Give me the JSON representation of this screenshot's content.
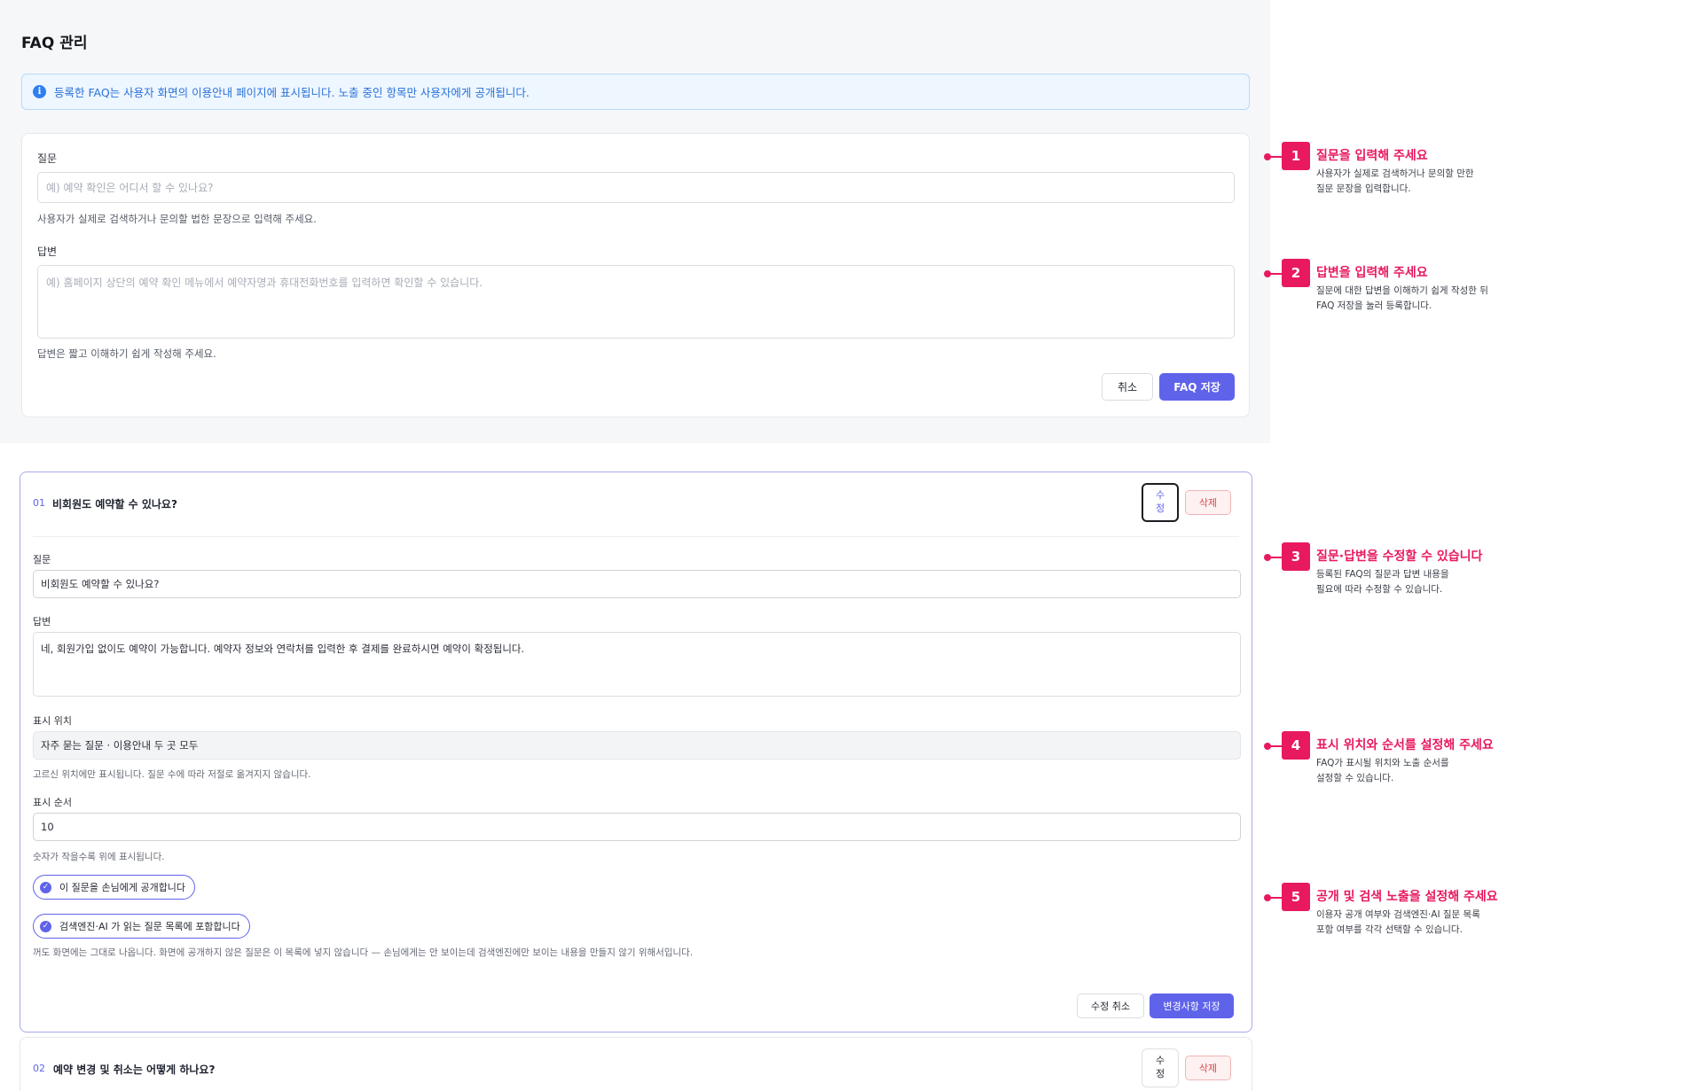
{
  "page": {
    "title": "FAQ 관리",
    "banner_icon": "info-icon",
    "banner_text": "등록한 FAQ는 사용자 화면의 이용안내 페이지에 표시됩니다. 노출 중인 항목만 사용자에게 공개됩니다."
  },
  "form": {
    "question_label": "질문",
    "question_placeholder": "예) 예약 확인은 어디서 할 수 있나요?",
    "question_hint": "사용자가 실제로 검색하거나 문의할 법한 문장으로 입력해 주세요.",
    "answer_label": "답변",
    "answer_placeholder": "예) 홈페이지 상단의 예약 확인 메뉴에서 예약자명과 휴대전화번호를 입력하면 확인할 수 있습니다.",
    "answer_hint": "답변은 짧고 이해하기 쉽게 작성해 주세요.",
    "cancel_label": "취소",
    "save_label": "FAQ 저장"
  },
  "faq_items": [
    {
      "number": "01",
      "title": "비회원도 예약할 수 있나요?",
      "edit_label_1": "수",
      "edit_label_2": "정",
      "delete_label": "삭제",
      "question_label": "질문",
      "question_value": "비회원도 예약할 수 있나요?",
      "answer_label": "답변",
      "answer_value": "네, 회원가입 없이도 예약이 가능합니다. 예약자 정보와 연락처를 입력한 후 결제를 완료하시면 예약이 확정됩니다.",
      "position_label": "표시 위치",
      "position_value": "자주 묻는 질문 · 이용안내 두 곳 모두",
      "position_hint": "고르신 위치에만 표시됩니다. 질문 수에 따라 저절로 옮겨지지 않습니다.",
      "order_label": "표시 순서",
      "order_value": "10",
      "order_hint": "숫자가 작을수록 위에 표시됩니다.",
      "public_check_label": "이 질문을 손님에게 공개합니다",
      "public_checked": true,
      "search_check_label": "검색엔진·AI 가 읽는 질문 목록에 포함합니다",
      "search_checked": true,
      "search_hint": "꺼도 화면에는 그대로 나옵니다. 화면에 공개하지 않은 질문은 이 목록에 넣지 않습니다 — 손님에게는 안 보이는데 검색엔진에만 보이는 내용을 만들지 않기 위해서입니다.",
      "cancel_edit_label": "수정 취소",
      "save_changes_label": "변경사항 저장"
    },
    {
      "number": "02",
      "title": "예약 변경 및 취소는 어떻게 하나요?",
      "edit_label_1": "수",
      "edit_label_2": "정",
      "delete_label": "삭제"
    }
  ],
  "annotations": [
    {
      "badge": "1",
      "title": "질문을 입력해 주세요",
      "desc_1": "사용자가 실제로 검색하거나 문의할 만한",
      "desc_2": "질문 문장을 입력합니다."
    },
    {
      "badge": "2",
      "title": "답변을 입력해 주세요",
      "desc_1": "질문에 대한 답변을 이해하기 쉽게 작성한 뒤",
      "desc_2": "FAQ 저장을 눌러 등록합니다."
    },
    {
      "badge": "3",
      "title": "질문·답변을 수정할 수 있습니다",
      "desc_1": "등록된 FAQ의 질문과 답변 내용을",
      "desc_2": "필요에 따라 수정할 수 있습니다."
    },
    {
      "badge": "4",
      "title": "표시 위치와 순서를 설정해 주세요",
      "desc_1": "FAQ가 표시될 위치와 노출 순서를",
      "desc_2": "설정할 수 있습니다."
    },
    {
      "badge": "5",
      "title": "공개 및 검색 노출을 설정해 주세요",
      "desc_1": "이용자 공개 여부와 검색엔진·AI 질문 목록",
      "desc_2": "포함 여부를 각각 선택할 수 있습니다."
    }
  ],
  "colors": {
    "accent": "#5f63ea",
    "annotation": "#e8195f",
    "banner_text": "#2a72d8",
    "danger": "#d84a4a"
  }
}
